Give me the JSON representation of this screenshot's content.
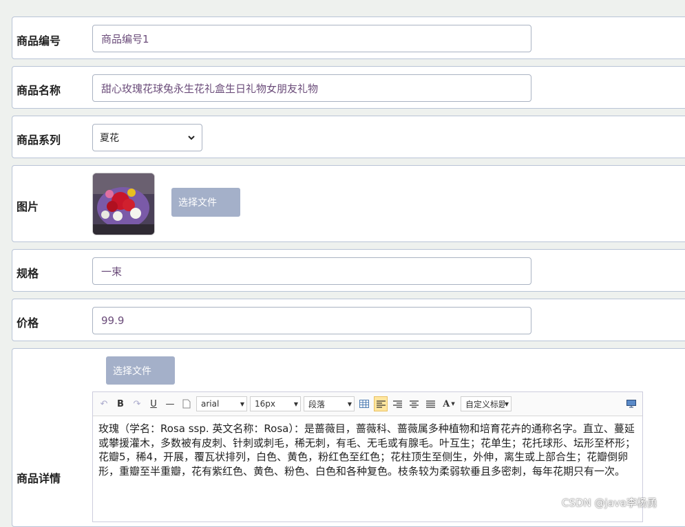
{
  "form": {
    "product_id": {
      "label": "商品编号",
      "value": "商品编号1"
    },
    "product_name": {
      "label": "商品名称",
      "value": "甜心玫瑰花球兔永生花礼盒生日礼物女朋友礼物"
    },
    "product_series": {
      "label": "商品系列",
      "value": "夏花",
      "arrow": "⌄"
    },
    "image": {
      "label": "图片",
      "file_button": "选择文件"
    },
    "spec": {
      "label": "规格",
      "value": "一束"
    },
    "price": {
      "label": "价格",
      "value": "99.9"
    },
    "details": {
      "label": "商品详情",
      "file_button": "选择文件",
      "toolbar": {
        "undo": "↶",
        "bold": "B",
        "redo": "↷",
        "underline": "U",
        "hr": "—",
        "font_family": "arial",
        "font_size": "16px",
        "paragraph": "段落",
        "font_color": "A",
        "custom_title": "自定义标题"
      },
      "content": "玫瑰（学名：Rosa ssp. 英文名称：Rosa）：是蔷薇目，蔷薇科、蔷薇属多种植物和培育花卉的通称名字。直立、蔓延或攀援灌木，多数被有皮刺、针刺或刺毛，稀无刺，有毛、无毛或有腺毛。叶互生；花单生；花托球形、坛形至杯形；花瓣5，稀4，开展，覆瓦状排列，白色、黄色，粉红色至红色；花柱顶生至侧生，外伸，离生或上部合生；花瓣倒卵形，重瓣至半重瓣，花有紫红色、黄色、粉色、白色和各种复色。枝条较为柔弱软垂且多密刺，每年花期只有一次。"
    }
  },
  "watermark": "CSDN @java李杨勇",
  "colors": {
    "file_button_bg": "#a4b0c9",
    "value_text": "#6b4c7a",
    "border": "#b8c3d6",
    "active_align": "#ffe69f"
  }
}
